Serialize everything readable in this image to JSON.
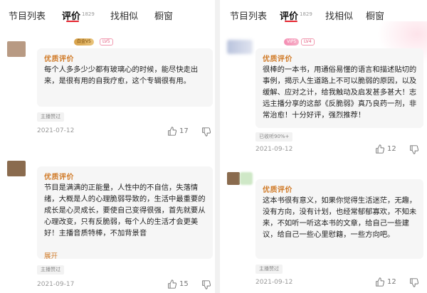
{
  "left": {
    "tabs": [
      {
        "label": "节目列表"
      },
      {
        "label": "评价",
        "count": "1829"
      },
      {
        "label": "找相似"
      },
      {
        "label": "橱窗"
      }
    ],
    "posts": [
      {
        "badge": "白金V5",
        "level": "LV5",
        "title": "优质评价",
        "text": "每个人多多少少都有玻璃心的时候，能尽快走出来，是很有用的自我疗愈，这个专辑很有用。",
        "tag": "主播赞过",
        "date": "2021-07-12",
        "likes": "17"
      },
      {
        "title": "优质评价",
        "text": "节目是满满的正能量，人性中的不自信，失落情绪，大概是人的心理脆弱导致的，生活中最重要的成长是心灵成长，要使自己变得很强，首先就要从心理改变，只有反脆弱，每个人的生活才会更美好！主播音质特棒，不加背景音",
        "expand": "展开",
        "tag": "主播赞过",
        "date": "2021-09-17",
        "likes": "15"
      }
    ]
  },
  "right": {
    "tabs": [
      {
        "label": "节目列表"
      },
      {
        "label": "评价",
        "count": "1829"
      },
      {
        "label": "找相似"
      },
      {
        "label": "橱窗"
      }
    ],
    "posts": [
      {
        "badge": "VIP5",
        "level": "LV4",
        "title": "优质评价",
        "text": "很棒的一本书，用通俗易懂的语言和描述贴切的事例，揭示人生道路上不可以脆弱的原因，以及缓解、应对之计，给我触动及启发甚多甚大！志远主播分享的这部《反脆弱》真乃良药一剂，非常治愈！十分好评，强烈推荐！",
        "tag": "已收听90%+",
        "date": "2021-09-12",
        "likes": "12"
      },
      {
        "title": "优质评价",
        "text": "这本书很有意义，如果你觉得生活迷茫，无趣，没有方向，没有计划，也经常郁郁寡欢，不知未来，不如听一听这本书的文章，给自己一些建议，给自己一些心里慰籍，一些方向吧。",
        "tag": "主播赞过",
        "date": "2021-09-12",
        "likes": "12"
      }
    ]
  },
  "colors": {
    "accent": "#e6242f",
    "quality_title": "#d07a27",
    "card_bg": "#f6f6f6",
    "muted": "#999999"
  },
  "icons": {
    "like": "thumbs-up-icon",
    "dislike": "thumbs-down-icon"
  }
}
